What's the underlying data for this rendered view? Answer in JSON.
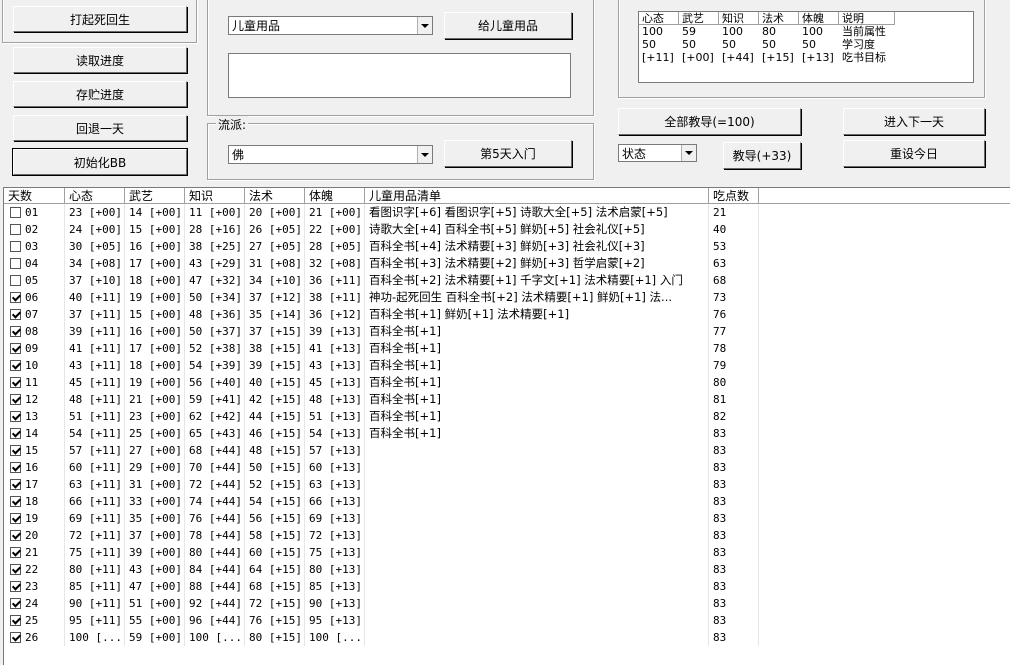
{
  "left_buttons": {
    "revive": "打起死回生",
    "load": "读取进度",
    "save": "存贮进度",
    "back": "回退一天",
    "init": "初始化BB"
  },
  "item_panel": {
    "combo_value": "儿童用品",
    "give_button": "给儿童用品",
    "textarea_value": ""
  },
  "school_panel": {
    "label": "流派:",
    "combo_value": "佛",
    "intro_button": "第5天入门"
  },
  "attr_table": {
    "columns": [
      "心态",
      "武艺",
      "知识",
      "法术",
      "体魄",
      "说明"
    ],
    "rows": [
      [
        "100",
        "59",
        "100",
        "80",
        "100",
        "当前属性"
      ],
      [
        "50",
        "50",
        "50",
        "50",
        "50",
        "学习度"
      ],
      [
        "[+11]",
        "[+00]",
        "[+44]",
        "[+15]",
        "[+13]",
        "吃书目标"
      ]
    ]
  },
  "right_controls": {
    "teach_all": "全部教导(=100)",
    "next_day": "进入下一天",
    "state_combo": "状态",
    "teach": "教导(+33)",
    "reset_today": "重设今日"
  },
  "big_table": {
    "columns": [
      "天数",
      "心态",
      "武艺",
      "知识",
      "法术",
      "体魄",
      "儿童用品清单",
      "吃点数"
    ],
    "rows": [
      {
        "day": "01",
        "checked": false,
        "c1": "23 [+00]",
        "c2": "14 [+00]",
        "c3": "11 [+00]",
        "c4": "20 [+00]",
        "c5": "21 [+00]",
        "items": "看图识字[+6] 看图识字[+5] 诗歌大全[+5] 法术启蒙[+5]",
        "pts": "21"
      },
      {
        "day": "02",
        "checked": false,
        "c1": "24 [+00]",
        "c2": "15 [+00]",
        "c3": "28 [+16]",
        "c4": "26 [+05]",
        "c5": "22 [+00]",
        "items": "诗歌大全[+4] 百科全书[+5] 鲜奶[+5] 社会礼仪[+5]",
        "pts": "40"
      },
      {
        "day": "03",
        "checked": false,
        "c1": "30 [+05]",
        "c2": "16 [+00]",
        "c3": "38 [+25]",
        "c4": "27 [+05]",
        "c5": "28 [+05]",
        "items": "百科全书[+4] 法术精要[+3] 鲜奶[+3] 社会礼仪[+3]",
        "pts": "53"
      },
      {
        "day": "04",
        "checked": false,
        "c1": "34 [+08]",
        "c2": "17 [+00]",
        "c3": "43 [+29]",
        "c4": "31 [+08]",
        "c5": "32 [+08]",
        "items": "百科全书[+3] 法术精要[+2] 鲜奶[+3] 哲学启蒙[+2]",
        "pts": "63"
      },
      {
        "day": "05",
        "checked": false,
        "c1": "37 [+10]",
        "c2": "18 [+00]",
        "c3": "47 [+32]",
        "c4": "34 [+10]",
        "c5": "36 [+11]",
        "items": "百科全书[+2] 法术精要[+1] 千字文[+1] 法术精要[+1] 入门",
        "pts": "68"
      },
      {
        "day": "06",
        "checked": true,
        "c1": "40 [+11]",
        "c2": "19 [+00]",
        "c3": "50 [+34]",
        "c4": "37 [+12]",
        "c5": "38 [+11]",
        "items": "神功-起死回生 百科全书[+2] 法术精要[+1] 鲜奶[+1] 法...",
        "pts": "73"
      },
      {
        "day": "07",
        "checked": true,
        "c1": "37 [+11]",
        "c2": "15 [+00]",
        "c3": "48 [+36]",
        "c4": "35 [+14]",
        "c5": "36 [+12]",
        "items": "百科全书[+1] 鲜奶[+1] 法术精要[+1]",
        "pts": "76"
      },
      {
        "day": "08",
        "checked": true,
        "c1": "39 [+11]",
        "c2": "16 [+00]",
        "c3": "50 [+37]",
        "c4": "37 [+15]",
        "c5": "39 [+13]",
        "items": "百科全书[+1]",
        "pts": "77"
      },
      {
        "day": "09",
        "checked": true,
        "c1": "41 [+11]",
        "c2": "17 [+00]",
        "c3": "52 [+38]",
        "c4": "38 [+15]",
        "c5": "41 [+13]",
        "items": "百科全书[+1]",
        "pts": "78"
      },
      {
        "day": "10",
        "checked": true,
        "c1": "43 [+11]",
        "c2": "18 [+00]",
        "c3": "54 [+39]",
        "c4": "39 [+15]",
        "c5": "43 [+13]",
        "items": "百科全书[+1]",
        "pts": "79"
      },
      {
        "day": "11",
        "checked": true,
        "c1": "45 [+11]",
        "c2": "19 [+00]",
        "c3": "56 [+40]",
        "c4": "40 [+15]",
        "c5": "45 [+13]",
        "items": "百科全书[+1]",
        "pts": "80"
      },
      {
        "day": "12",
        "checked": true,
        "c1": "48 [+11]",
        "c2": "21 [+00]",
        "c3": "59 [+41]",
        "c4": "42 [+15]",
        "c5": "48 [+13]",
        "items": "百科全书[+1]",
        "pts": "81"
      },
      {
        "day": "13",
        "checked": true,
        "c1": "51 [+11]",
        "c2": "23 [+00]",
        "c3": "62 [+42]",
        "c4": "44 [+15]",
        "c5": "51 [+13]",
        "items": "百科全书[+1]",
        "pts": "82"
      },
      {
        "day": "14",
        "checked": true,
        "c1": "54 [+11]",
        "c2": "25 [+00]",
        "c3": "65 [+43]",
        "c4": "46 [+15]",
        "c5": "54 [+13]",
        "items": "百科全书[+1]",
        "pts": "83"
      },
      {
        "day": "15",
        "checked": true,
        "c1": "57 [+11]",
        "c2": "27 [+00]",
        "c3": "68 [+44]",
        "c4": "48 [+15]",
        "c5": "57 [+13]",
        "items": "",
        "pts": "83"
      },
      {
        "day": "16",
        "checked": true,
        "c1": "60 [+11]",
        "c2": "29 [+00]",
        "c3": "70 [+44]",
        "c4": "50 [+15]",
        "c5": "60 [+13]",
        "items": "",
        "pts": "83"
      },
      {
        "day": "17",
        "checked": true,
        "c1": "63 [+11]",
        "c2": "31 [+00]",
        "c3": "72 [+44]",
        "c4": "52 [+15]",
        "c5": "63 [+13]",
        "items": "",
        "pts": "83"
      },
      {
        "day": "18",
        "checked": true,
        "c1": "66 [+11]",
        "c2": "33 [+00]",
        "c3": "74 [+44]",
        "c4": "54 [+15]",
        "c5": "66 [+13]",
        "items": "",
        "pts": "83"
      },
      {
        "day": "19",
        "checked": true,
        "c1": "69 [+11]",
        "c2": "35 [+00]",
        "c3": "76 [+44]",
        "c4": "56 [+15]",
        "c5": "69 [+13]",
        "items": "",
        "pts": "83"
      },
      {
        "day": "20",
        "checked": true,
        "c1": "72 [+11]",
        "c2": "37 [+00]",
        "c3": "78 [+44]",
        "c4": "58 [+15]",
        "c5": "72 [+13]",
        "items": "",
        "pts": "83"
      },
      {
        "day": "21",
        "checked": true,
        "c1": "75 [+11]",
        "c2": "39 [+00]",
        "c3": "80 [+44]",
        "c4": "60 [+15]",
        "c5": "75 [+13]",
        "items": "",
        "pts": "83"
      },
      {
        "day": "22",
        "checked": true,
        "c1": "80 [+11]",
        "c2": "43 [+00]",
        "c3": "84 [+44]",
        "c4": "64 [+15]",
        "c5": "80 [+13]",
        "items": "",
        "pts": "83"
      },
      {
        "day": "23",
        "checked": true,
        "c1": "85 [+11]",
        "c2": "47 [+00]",
        "c3": "88 [+44]",
        "c4": "68 [+15]",
        "c5": "85 [+13]",
        "items": "",
        "pts": "83"
      },
      {
        "day": "24",
        "checked": true,
        "c1": "90 [+11]",
        "c2": "51 [+00]",
        "c3": "92 [+44]",
        "c4": "72 [+15]",
        "c5": "90 [+13]",
        "items": "",
        "pts": "83"
      },
      {
        "day": "25",
        "checked": true,
        "c1": "95 [+11]",
        "c2": "55 [+00]",
        "c3": "96 [+44]",
        "c4": "76 [+15]",
        "c5": "95 [+13]",
        "items": "",
        "pts": "83"
      },
      {
        "day": "26",
        "checked": true,
        "c1": "100 [...",
        "c2": "59 [+00]",
        "c3": "100 [...",
        "c4": "80 [+15]",
        "c5": "100 [...",
        "items": "",
        "pts": "83"
      }
    ]
  }
}
